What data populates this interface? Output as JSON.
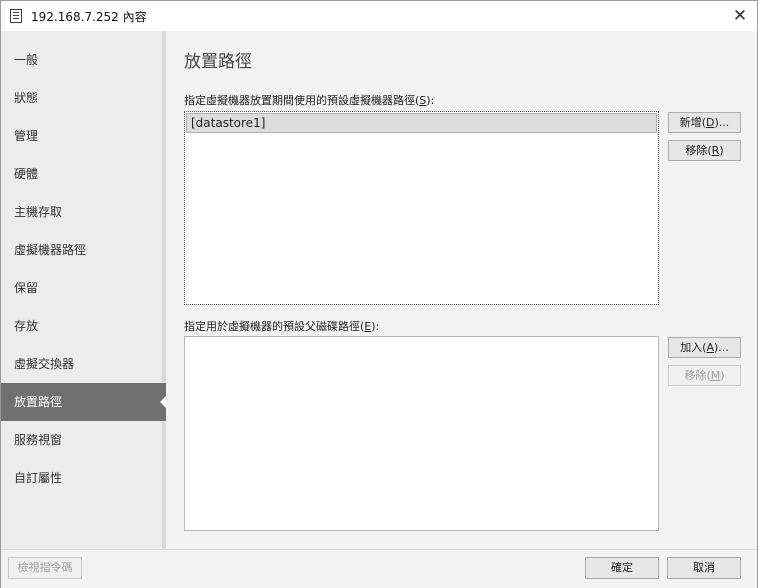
{
  "window": {
    "title": "192.168.7.252 內容"
  },
  "sidebar": {
    "items": [
      {
        "label": "一般"
      },
      {
        "label": "狀態"
      },
      {
        "label": "管理"
      },
      {
        "label": "硬體"
      },
      {
        "label": "主機存取"
      },
      {
        "label": "虛擬機器路徑"
      },
      {
        "label": "保留"
      },
      {
        "label": "存放"
      },
      {
        "label": "虛擬交換器"
      },
      {
        "label": "放置路徑",
        "active": true
      },
      {
        "label": "服務視窗"
      },
      {
        "label": "自訂屬性"
      }
    ]
  },
  "main": {
    "title": "放置路徑",
    "vm_paths": {
      "label_text": "指定虛擬機器放置期間使用的預設虛擬機器路徑(",
      "label_key": "S",
      "label_end": "):",
      "items": [
        "[datastore1]"
      ],
      "add_text": "新增(",
      "add_key": "D",
      "add_end": ")...",
      "remove_text": "移除(",
      "remove_key": "R",
      "remove_end": ")"
    },
    "disk_paths": {
      "label_text": "指定用於虛擬機器的預設父磁碟路徑(",
      "label_key": "E",
      "label_end": "):",
      "items": [],
      "add_text": "加入(",
      "add_key": "A",
      "add_end": ")...",
      "remove_text": "移除(",
      "remove_key": "M",
      "remove_end": ")"
    }
  },
  "footer": {
    "view_script": "檢視指令碼",
    "ok": "確定",
    "cancel": "取消"
  }
}
